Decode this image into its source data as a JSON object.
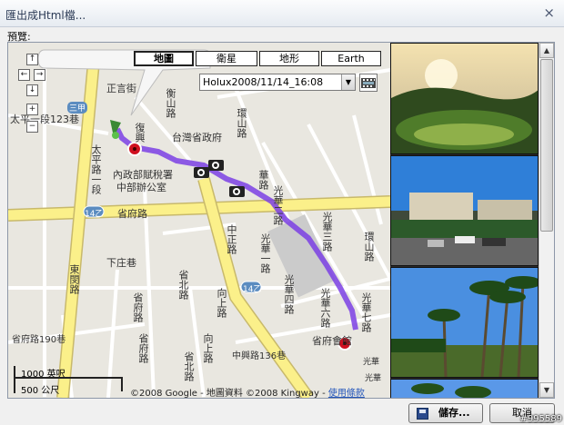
{
  "window": {
    "title": "匯出成Html檔...",
    "close_glyph": "×"
  },
  "preview_label": "預覽:",
  "map": {
    "map_types": [
      "地圖",
      "衛星",
      "地形",
      "Earth"
    ],
    "active_map_type": "地圖",
    "track_select": {
      "value": "Holux2008/11/14_16:08",
      "arrow_glyph": "▼"
    },
    "nav": {
      "up": "↑",
      "left": "←",
      "right": "→",
      "down": "↓",
      "zoom_in": "+",
      "zoom_out": "−"
    },
    "labels": {
      "zhengyan": "正言街",
      "sanjia": "三甲",
      "taiping_1": "太平一段123巷",
      "hengshan": "衡山路",
      "fuxing": "復興",
      "taiping_road": "太平路一段",
      "huanshan_top": "環山路",
      "taiwan_gov": "台灣省政府",
      "neizheng": "內政部賦稅署",
      "zhongbu": "中部辦公室",
      "huayang": "華路",
      "route14_left": "14乙",
      "shengfu": "省府路",
      "guangtang": "光華二路",
      "guanghua3": "光華三路",
      "huanshan_right": "環山路",
      "zhongzheng": "中正路",
      "guanghua1": "光華一路",
      "xiazhuang": "下庄巷",
      "dongguan": "東閔路",
      "shengbei": "省北路",
      "xiangshang": "向上路",
      "route14_mid": "14乙",
      "guanghua4": "光華四路",
      "guanghua6": "光華六路",
      "guanghua7": "光華七路",
      "shengfu_mid": "省府路",
      "guangtang_side": "省府路190巷",
      "zhongxing": "中興路136巷",
      "xiangshang2": "向上路",
      "shengfu_lower": "省府路",
      "shengbei2": "省北路",
      "shengfu_hall": "省府會館",
      "guangwa": "光華",
      "guangda": "光華"
    },
    "scale": {
      "feet": "1000 英呎",
      "meters": "500 公尺"
    },
    "copyright": {
      "text": "©2008 Google - 地圖資料 ©2008 Kingway - ",
      "link": "使用條款"
    }
  },
  "photos": [
    {
      "name": "garden-sunset"
    },
    {
      "name": "building-parking"
    },
    {
      "name": "palm-park"
    },
    {
      "name": "palm-sky"
    }
  ],
  "buttons": {
    "save": "儲存...",
    "cancel": "取消"
  },
  "watermark": "#995589"
}
